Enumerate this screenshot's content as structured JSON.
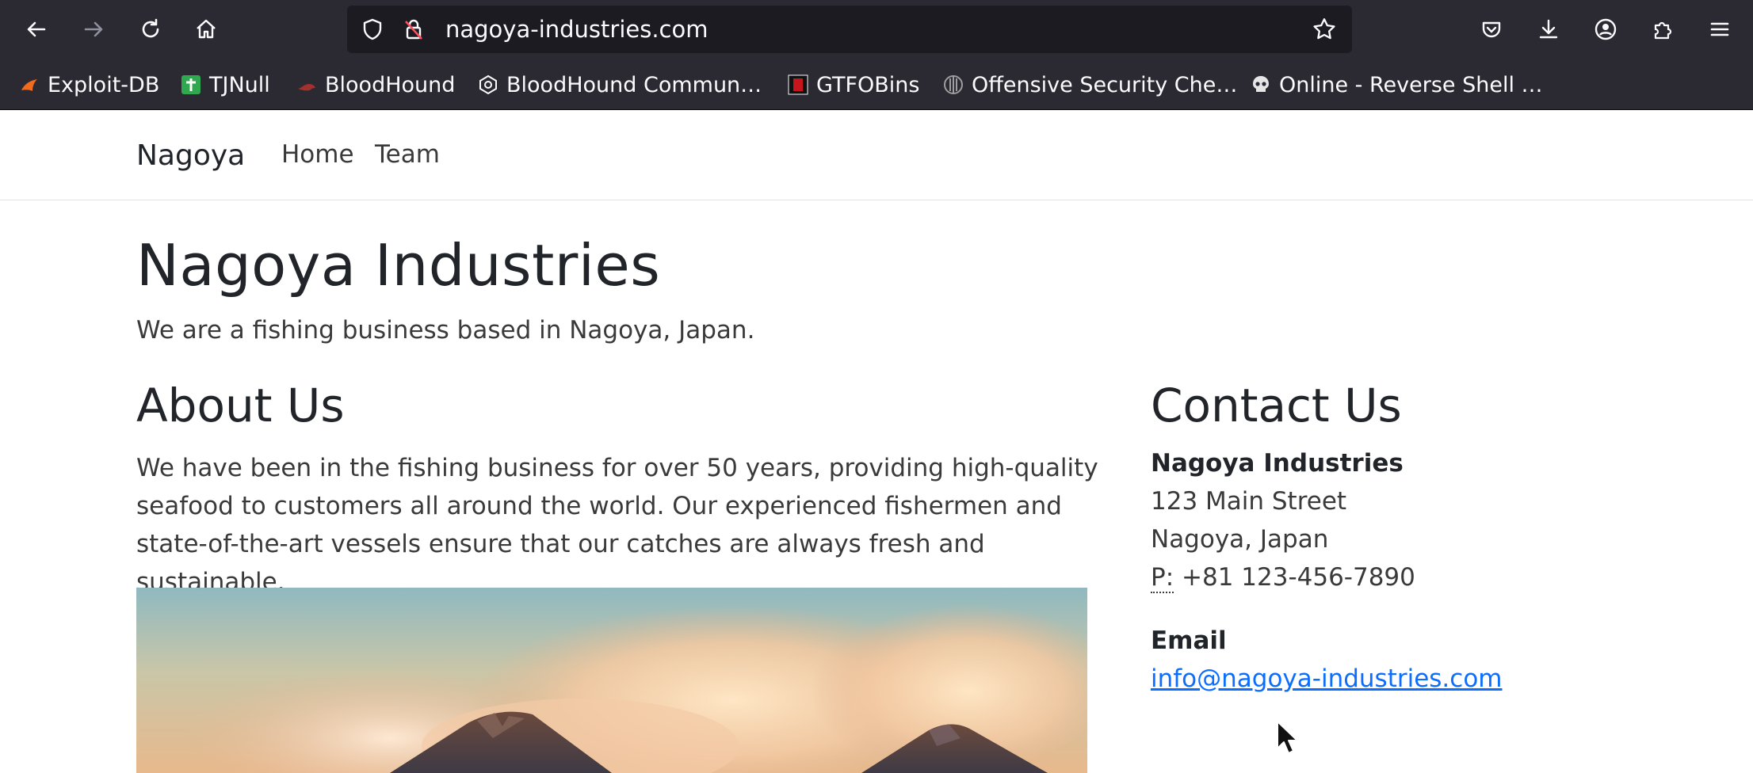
{
  "browser": {
    "url": "nagoya-industries.com",
    "bookmarks": [
      {
        "label": "Exploit-DB",
        "icon": "exploit-db-icon"
      },
      {
        "label": "TJNull",
        "icon": "tjnull-icon"
      },
      {
        "label": "BloodHound",
        "icon": "bloodhound-icon"
      },
      {
        "label": "BloodHound Commun…",
        "icon": "bloodhound-community-icon"
      },
      {
        "label": "GTFOBins",
        "icon": "gtfobins-icon"
      },
      {
        "label": "Offensive Security Che…",
        "icon": "offsec-icon"
      },
      {
        "label": "Online - Reverse Shell …",
        "icon": "skull-icon"
      }
    ],
    "colors": {
      "chrome": "#2b2a33",
      "urlbar": "#1c1b22",
      "text": "#fbfbfe"
    }
  },
  "nav": {
    "brand": "Nagoya",
    "links": [
      "Home",
      "Team"
    ]
  },
  "header": {
    "title": "Nagoya Industries",
    "lead": "We are a fishing business based in Nagoya, Japan."
  },
  "about": {
    "heading": "About Us",
    "text": "We have been in the fishing business for over 50 years, providing high-quality seafood to customers all around the world. Our experienced fishermen and state-of-the-art vessels ensure that our catches are always fresh and sustainable.",
    "image_alt": "volcanic mountains under sunset clouds"
  },
  "contact": {
    "heading": "Contact Us",
    "company": "Nagoya Industries",
    "street": "123 Main Street",
    "city": "Nagoya, Japan",
    "phone_label": "P:",
    "phone": "+81 123-456-7890",
    "email_heading": "Email",
    "email": "info@nagoya-industries.com"
  },
  "colors": {
    "link": "#0d6efd",
    "heading": "#212529",
    "text": "#3a3a3a"
  }
}
